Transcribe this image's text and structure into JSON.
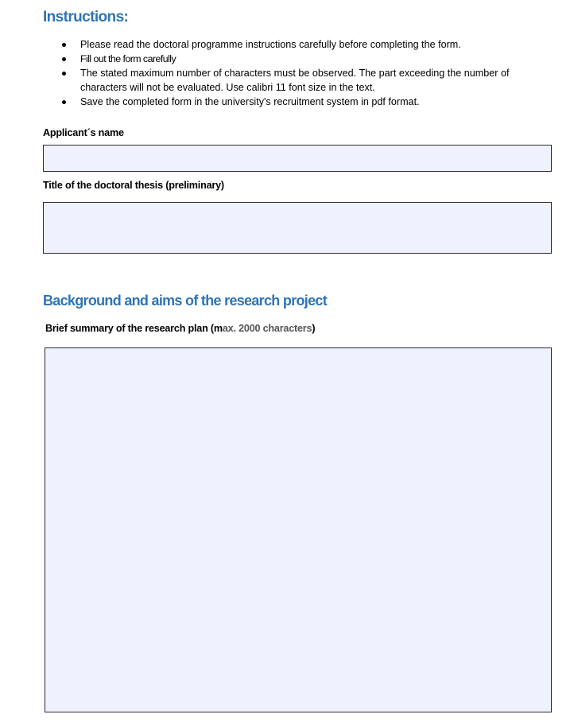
{
  "instructions": {
    "heading": "Instructions:",
    "items": [
      "Please read the doctoral programme instructions carefully before completing the form.",
      "Fill out the form carefully",
      "The stated maximum number of characters must be observed. The part exceeding the number of characters will not be evaluated. Use calibri 11 font size in the text.",
      "Save the completed form in the university's recruitment system in pdf format."
    ]
  },
  "fields": {
    "applicant_name": {
      "label": "Applicant´s name",
      "value": ""
    },
    "thesis_title": {
      "label": "Title of the doctoral thesis (preliminary)",
      "value": ""
    }
  },
  "section": {
    "heading": "Background and aims of the research project",
    "summary": {
      "label_prefix": "Brief summary of the research plan (m",
      "label_limit": "ax. 2000 characters",
      "label_suffix": ")",
      "value": ""
    }
  },
  "colors": {
    "heading_blue": "#2e74b5",
    "field_fill": "#eff2fe",
    "field_border": "#2b2b2b"
  }
}
